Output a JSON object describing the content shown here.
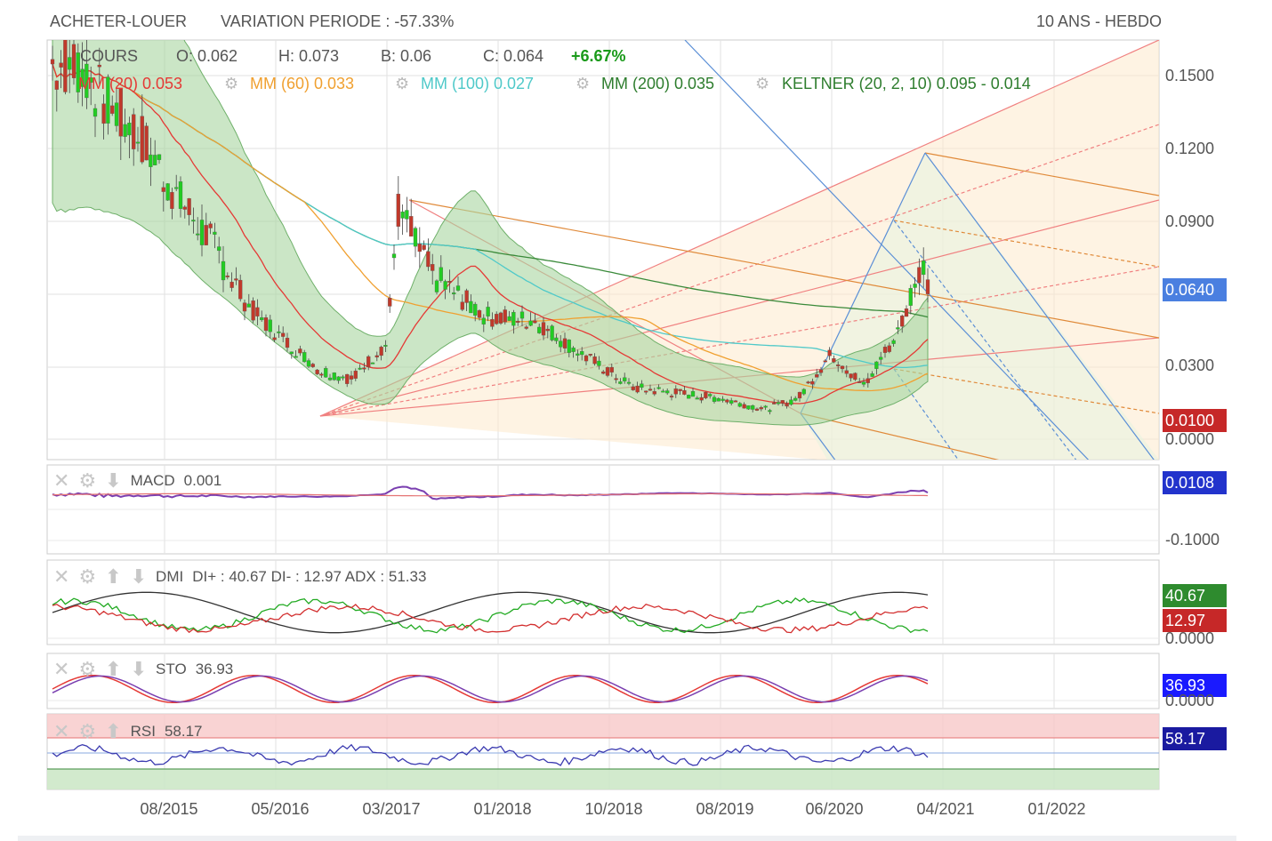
{
  "header": {
    "left": "ACHETER-LOUER",
    "variation": "VARIATION PERIODE : -57.33%",
    "right": "10 ANS - HEBDO"
  },
  "ohlc": {
    "cours": "COURS",
    "o": "O: 0.062",
    "h": "H: 0.073",
    "b": "B: 0.06",
    "c": "C: 0.064",
    "change": "+6.67%"
  },
  "indicators": {
    "mm20": "MM (20)  0.053",
    "mm60": "MM (60)  0.033",
    "mm100": "MM (100)  0.027",
    "mm200": "MM (200)  0.035",
    "keltner": "KELTNER (20, 2, 10)  0.095 - 0.014"
  },
  "price_axis": [
    "0.1500",
    "0.1200",
    "0.0900",
    "0.0300",
    "0.0000"
  ],
  "badges": {
    "price": "0.0640",
    "low": "0.0100",
    "macd": "0.0108",
    "diplus": "40.67",
    "diminus": "12.97",
    "sto": "36.93",
    "rsi": "58.17"
  },
  "panels": {
    "macd": {
      "name": "MACD",
      "value": "0.001",
      "axis_low": "-0.1000"
    },
    "dmi": {
      "name": "DMI",
      "value": "DI+ : 40.67 DI- : 12.97 ADX : 51.33",
      "axis_low": "0.0000"
    },
    "sto": {
      "name": "STO",
      "value": "36.93",
      "axis_low": "0.0000"
    },
    "rsi": {
      "name": "RSI",
      "value": "58.17"
    }
  },
  "dates": [
    "08/2015",
    "05/2016",
    "03/2017",
    "01/2018",
    "10/2018",
    "08/2019",
    "06/2020",
    "04/2021",
    "01/2022"
  ],
  "colors": {
    "up": "#22cc22",
    "down": "#c0392b",
    "mm20": "#e53935",
    "mm60": "#f0a030",
    "mm100": "#4fc9c9",
    "mm200": "#3a8a3a",
    "keltner_fill": "#a8d5a0",
    "macd_line": "#7a3fb0",
    "dmi_plus": "#22aa22",
    "dmi_minus": "#d32f2f",
    "adx": "#333333"
  },
  "chart_data": {
    "type": "candlestick",
    "timeframe": "weekly",
    "ylim": [
      0,
      0.16
    ],
    "x_ticks": [
      "08/2015",
      "05/2016",
      "03/2017",
      "01/2018",
      "10/2018",
      "08/2019",
      "06/2020",
      "04/2021",
      "01/2022"
    ],
    "y_ticks": [
      0.15,
      0.12,
      0.09,
      0.064,
      0.03,
      0.01,
      0
    ],
    "close_path": [
      {
        "date": "2015-01",
        "value": 0.155
      },
      {
        "date": "2015-03",
        "value": 0.14
      },
      {
        "date": "2015-06",
        "value": 0.125
      },
      {
        "date": "2015-09",
        "value": 0.1
      },
      {
        "date": "2015-12",
        "value": 0.08
      },
      {
        "date": "2016-03",
        "value": 0.055
      },
      {
        "date": "2016-06",
        "value": 0.04
      },
      {
        "date": "2016-09",
        "value": 0.028
      },
      {
        "date": "2016-12",
        "value": 0.025
      },
      {
        "date": "2017-03",
        "value": 0.04
      },
      {
        "date": "2017-04",
        "value": 0.095
      },
      {
        "date": "2017-07",
        "value": 0.07
      },
      {
        "date": "2017-12",
        "value": 0.052
      },
      {
        "date": "2018-04",
        "value": 0.05
      },
      {
        "date": "2018-08",
        "value": 0.034
      },
      {
        "date": "2018-12",
        "value": 0.022
      },
      {
        "date": "2019-04",
        "value": 0.02
      },
      {
        "date": "2019-08",
        "value": 0.018
      },
      {
        "date": "2019-12",
        "value": 0.014
      },
      {
        "date": "2020-03",
        "value": 0.018
      },
      {
        "date": "2020-06",
        "value": 0.035
      },
      {
        "date": "2020-09",
        "value": 0.022
      },
      {
        "date": "2020-12",
        "value": 0.045
      },
      {
        "date": "2021-02",
        "value": 0.075
      },
      {
        "date": "2021-03",
        "value": 0.064
      }
    ],
    "last": {
      "open": 0.062,
      "high": 0.073,
      "low": 0.06,
      "close": 0.064,
      "change_pct": 6.67
    },
    "moving_averages": {
      "mm20": 0.053,
      "mm60": 0.033,
      "mm100": 0.027,
      "mm200": 0.035
    },
    "keltner": {
      "upper": 0.095,
      "lower": 0.014
    },
    "oscillators": {
      "macd": 0.001,
      "di_plus": 40.67,
      "di_minus": 12.97,
      "adx": 51.33,
      "sto": 36.93,
      "rsi": 58.17
    }
  }
}
